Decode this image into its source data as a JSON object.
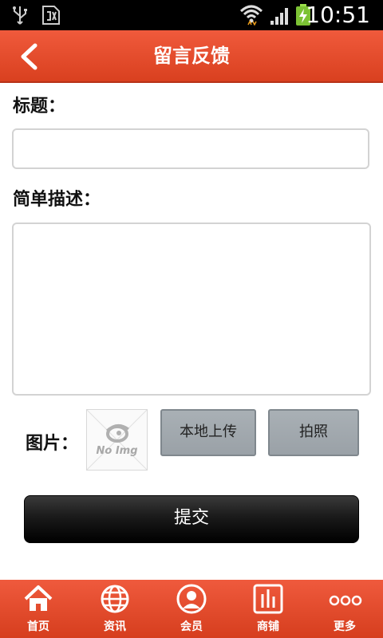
{
  "status_bar": {
    "time": "10:51"
  },
  "header": {
    "title": "留言反馈"
  },
  "form": {
    "title_label": "标题：",
    "title_value": "",
    "desc_label": "简单描述：",
    "desc_value": "",
    "image_label": "图片：",
    "no_image_text": "No Img",
    "upload_label": "本地上传",
    "photo_label": "拍照",
    "submit_label": "提交"
  },
  "tabbar": {
    "items": [
      {
        "label": "首页",
        "icon": "home-icon"
      },
      {
        "label": "资讯",
        "icon": "globe-icon"
      },
      {
        "label": "会员",
        "icon": "user-icon"
      },
      {
        "label": "商铺",
        "icon": "shop-chart-icon"
      },
      {
        "label": "更多",
        "icon": "more-dots-icon"
      }
    ]
  },
  "colors": {
    "accent": "#e04a2a",
    "button_grey": "#a4abb0",
    "submit": "#111111"
  }
}
